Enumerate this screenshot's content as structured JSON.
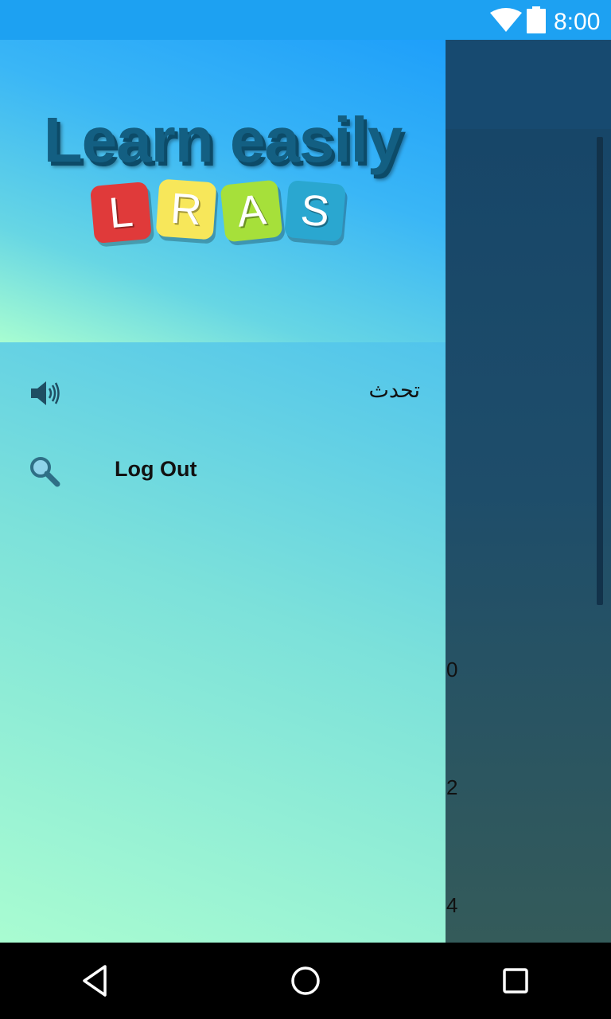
{
  "status_bar": {
    "time": "8:00"
  },
  "drawer": {
    "logo": {
      "title": "Learn easily",
      "tiles": [
        {
          "letter": "L",
          "color": "#e03a3a"
        },
        {
          "letter": "R",
          "color": "#f7e75a"
        },
        {
          "letter": "A",
          "color": "#a6e03a"
        },
        {
          "letter": "S",
          "color": "#2aa7d0"
        }
      ]
    },
    "menu": [
      {
        "label": "تحدث",
        "icon": "speaker-icon"
      },
      {
        "label": "Log Out",
        "icon": "search-icon"
      }
    ]
  },
  "background": {
    "numbers": [
      "0",
      "2",
      "4"
    ]
  },
  "nav_bar": {
    "buttons": [
      "back-icon",
      "home-icon",
      "recents-icon"
    ]
  }
}
